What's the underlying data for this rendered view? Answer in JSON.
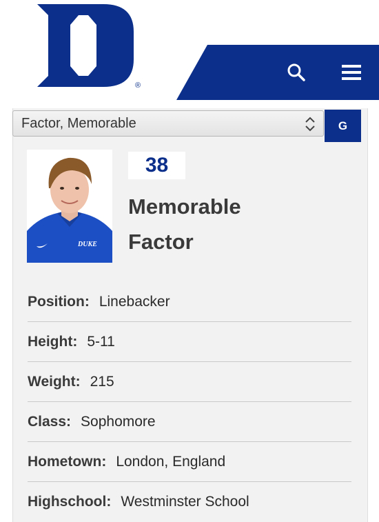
{
  "colors": {
    "brand_blue": "#0b2f8a",
    "card_bg": "#f2f2f2"
  },
  "header": {
    "logo_icon": "duke-d-logo",
    "registered_mark": "®",
    "search_icon": "search-icon",
    "menu_icon": "hamburger-menu-icon"
  },
  "roster_select": {
    "value": "Factor, Memorable"
  },
  "go_button": {
    "label": "G"
  },
  "player": {
    "number": "38",
    "first_name": "Memorable",
    "last_name": "Factor",
    "shirt_text": "DUKE"
  },
  "details": {
    "position": {
      "label": "Position:",
      "value": "Linebacker"
    },
    "height": {
      "label": "Height:",
      "value": "5-11"
    },
    "weight": {
      "label": "Weight:",
      "value": "215"
    },
    "class": {
      "label": "Class:",
      "value": "Sophomore"
    },
    "hometown": {
      "label": "Hometown:",
      "value": "London, England"
    },
    "highschool": {
      "label": "Highschool:",
      "value": "Westminster School"
    }
  }
}
